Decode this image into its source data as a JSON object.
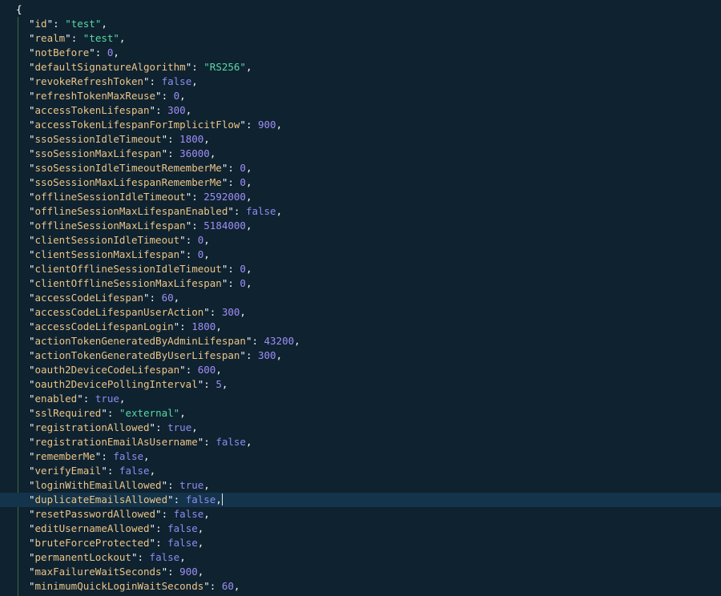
{
  "editor": {
    "open_brace": "{",
    "current_line_index": 33,
    "colors": {
      "background": "#0f2230",
      "key": "#ebc587",
      "number": "#9f8ff7",
      "boolean": "#8d8cf2",
      "string": "#59d8a4",
      "current_line": "#13344a",
      "indent_guide": "#3e6a3a"
    },
    "lines": [
      {
        "key": "id",
        "type": "string",
        "value": "\"test\""
      },
      {
        "key": "realm",
        "type": "string",
        "value": "\"test\""
      },
      {
        "key": "notBefore",
        "type": "number",
        "value": "0"
      },
      {
        "key": "defaultSignatureAlgorithm",
        "type": "string",
        "value": "\"RS256\""
      },
      {
        "key": "revokeRefreshToken",
        "type": "bool",
        "value": "false"
      },
      {
        "key": "refreshTokenMaxReuse",
        "type": "number",
        "value": "0"
      },
      {
        "key": "accessTokenLifespan",
        "type": "number",
        "value": "300"
      },
      {
        "key": "accessTokenLifespanForImplicitFlow",
        "type": "number",
        "value": "900"
      },
      {
        "key": "ssoSessionIdleTimeout",
        "type": "number",
        "value": "1800"
      },
      {
        "key": "ssoSessionMaxLifespan",
        "type": "number",
        "value": "36000"
      },
      {
        "key": "ssoSessionIdleTimeoutRememberMe",
        "type": "number",
        "value": "0"
      },
      {
        "key": "ssoSessionMaxLifespanRememberMe",
        "type": "number",
        "value": "0"
      },
      {
        "key": "offlineSessionIdleTimeout",
        "type": "number",
        "value": "2592000"
      },
      {
        "key": "offlineSessionMaxLifespanEnabled",
        "type": "bool",
        "value": "false"
      },
      {
        "key": "offlineSessionMaxLifespan",
        "type": "number",
        "value": "5184000"
      },
      {
        "key": "clientSessionIdleTimeout",
        "type": "number",
        "value": "0"
      },
      {
        "key": "clientSessionMaxLifespan",
        "type": "number",
        "value": "0"
      },
      {
        "key": "clientOfflineSessionIdleTimeout",
        "type": "number",
        "value": "0"
      },
      {
        "key": "clientOfflineSessionMaxLifespan",
        "type": "number",
        "value": "0"
      },
      {
        "key": "accessCodeLifespan",
        "type": "number",
        "value": "60"
      },
      {
        "key": "accessCodeLifespanUserAction",
        "type": "number",
        "value": "300"
      },
      {
        "key": "accessCodeLifespanLogin",
        "type": "number",
        "value": "1800"
      },
      {
        "key": "actionTokenGeneratedByAdminLifespan",
        "type": "number",
        "value": "43200"
      },
      {
        "key": "actionTokenGeneratedByUserLifespan",
        "type": "number",
        "value": "300"
      },
      {
        "key": "oauth2DeviceCodeLifespan",
        "type": "number",
        "value": "600"
      },
      {
        "key": "oauth2DevicePollingInterval",
        "type": "number",
        "value": "5"
      },
      {
        "key": "enabled",
        "type": "bool",
        "value": "true"
      },
      {
        "key": "sslRequired",
        "type": "string",
        "value": "\"external\""
      },
      {
        "key": "registrationAllowed",
        "type": "bool",
        "value": "true"
      },
      {
        "key": "registrationEmailAsUsername",
        "type": "bool",
        "value": "false"
      },
      {
        "key": "rememberMe",
        "type": "bool",
        "value": "false"
      },
      {
        "key": "verifyEmail",
        "type": "bool",
        "value": "false"
      },
      {
        "key": "loginWithEmailAllowed",
        "type": "bool",
        "value": "true"
      },
      {
        "key": "duplicateEmailsAllowed",
        "type": "bool",
        "value": "false"
      },
      {
        "key": "resetPasswordAllowed",
        "type": "bool",
        "value": "false"
      },
      {
        "key": "editUsernameAllowed",
        "type": "bool",
        "value": "false"
      },
      {
        "key": "bruteForceProtected",
        "type": "bool",
        "value": "false"
      },
      {
        "key": "permanentLockout",
        "type": "bool",
        "value": "false"
      },
      {
        "key": "maxFailureWaitSeconds",
        "type": "number",
        "value": "900"
      },
      {
        "key": "minimumQuickLoginWaitSeconds",
        "type": "number",
        "value": "60"
      }
    ]
  }
}
